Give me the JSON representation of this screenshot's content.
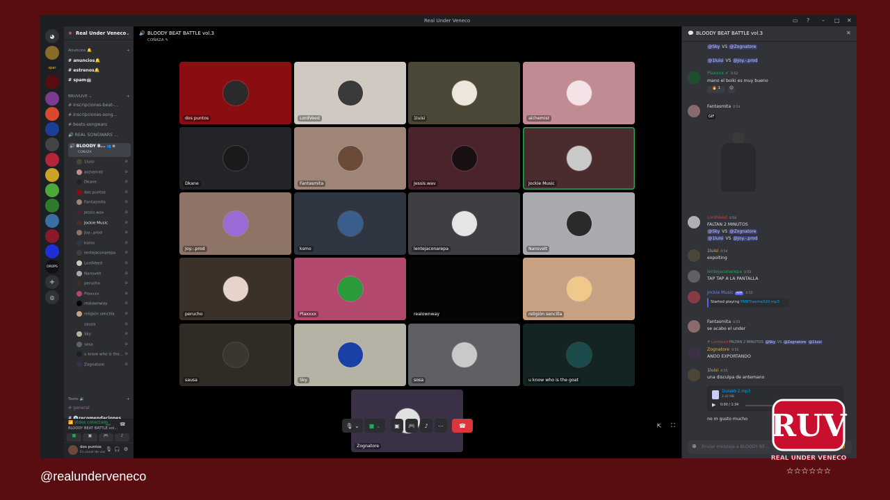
{
  "window": {
    "title": "Real Under Veneco"
  },
  "server": {
    "name": "Real Under Veneco"
  },
  "channels": {
    "cat_anuncios": "Anuncios",
    "anuncios": "anuncios",
    "estrenos": "estrenos",
    "spam": "spam",
    "cat_bruvlive": "BRUVLIVE",
    "inscripciones_beat": "inscripciones-beat-...",
    "inscripciones_song": "inscripciones-song...",
    "beats_songwars": "beats-songwars",
    "real_songwars": "REAL SONGWARS ...",
    "bloody": "BLOODY B...",
    "conaza": "COÑAZA",
    "cat_texto": "Texto",
    "general": "general",
    "recomendaciones": "recomendaciones"
  },
  "voice_members": [
    "1luisi",
    "alchemist",
    "Dkane",
    "dos puntos",
    "Fantasmita",
    "Jessis.wav",
    "Jockie Music",
    "Joy.-.prod",
    "ksmo",
    "lentejaconarepa",
    "LordVeed",
    "Nansvelt",
    "perucho",
    "Plaxxxx",
    "realownway",
    "religión sencilla",
    "sausa",
    "Sky",
    "sosa",
    "u know who is the...",
    "Zognatore"
  ],
  "voice_status": {
    "connected": "Video conectado",
    "channel": "BLOODY BEAT BATTLE vol..."
  },
  "user": {
    "name": "dos puntos",
    "status": "En canal de voz"
  },
  "call": {
    "title": "BLOODY BEAT BATTLE vol.3",
    "subtitle": "COÑAZA"
  },
  "tiles": [
    {
      "name": "dos puntos",
      "bg": "#8a0d12"
    },
    {
      "name": "LordVeed",
      "bg": "#cfc9c2"
    },
    {
      "name": "1luisi",
      "bg": "#4b4737"
    },
    {
      "name": "alchemist",
      "bg": "#c18b93"
    },
    {
      "name": "Dkane",
      "bg": "#232427"
    },
    {
      "name": "Fantasmita",
      "bg": "#9e8578"
    },
    {
      "name": "Jessis.wav",
      "bg": "#4b232b"
    },
    {
      "name": "Jockie Music",
      "bg": "#4b2c2e"
    },
    {
      "name": "Joy.-.prod",
      "bg": "#8e7367"
    },
    {
      "name": "ksmo",
      "bg": "#303641"
    },
    {
      "name": "lentejaconarepa",
      "bg": "#3e3f42"
    },
    {
      "name": "Nansvelt",
      "bg": "#a9aaad"
    },
    {
      "name": "perucho",
      "bg": "#3c3128"
    },
    {
      "name": "Plaxxxx",
      "bg": "#b2486d"
    },
    {
      "name": "realownway",
      "bg": "#050505"
    },
    {
      "name": "religión sencilla",
      "bg": "#c8a183"
    },
    {
      "name": "sausa",
      "bg": "#302b25"
    },
    {
      "name": "Sky",
      "bg": "#b5b3a5"
    },
    {
      "name": "sosa",
      "bg": "#5f6064"
    },
    {
      "name": "u know who is the goat",
      "bg": "#142423"
    },
    {
      "name": "Zognatore",
      "bg": "#3a3146"
    }
  ],
  "chat": {
    "title": "BLOODY BEAT BATTLE vol.3",
    "vs": "VS",
    "m_sky": "@Sky",
    "m_zog": "@Zognatore",
    "m_luisi": "@1luisi",
    "m_joy": "@Joy.-.prod",
    "plax_name": "Plaxxxx",
    "plax_time": "0:52",
    "plax_text": "mano el boiki es muy bueno",
    "fant_name": "Fantasmita",
    "fant_time": "0:54",
    "gif_label": "GIF",
    "lord_name": "LordVeed",
    "lord_time": "0:54",
    "lord_text": "FALTAN 2 MINUTOS",
    "luisi_name": "1luisi",
    "luisi_time": "0:54",
    "luisi_text": "expoiting",
    "lenteja_name": "lentejaconarepa",
    "lenteja_time": "0:55",
    "lenteja_text": "TAP TAP A LA PANTALLA",
    "jockie_name": "Jockie Music",
    "jockie_app": "APP",
    "jockie_time": "0:55",
    "jockie_playing": "Started playing",
    "jockie_track": "FANThasma320.mp3",
    "fant2_text": "se acabo el under",
    "reply_name": "LordVeed",
    "reply_text": "FALTAN 2 MINUTOS",
    "reply_mention": "@1luisi",
    "zog_name": "Zognatore",
    "zog_time": "0:55",
    "zog_text": "ANDO EXPORTANDO",
    "luisi2_time": "0:55",
    "luisi2_text": "una disculpa de antemano",
    "file_name": "1luisbb 2.mp3",
    "file_size": "2.42 MB",
    "file_time": "0:00 / 1:34",
    "last_text": "no m gusto mucho",
    "input_placeholder": "Enviar mensaje a BLOODY BE..."
  },
  "overlay": {
    "handle": "@realunderveneco",
    "logo_big": "RUV",
    "logo_text": "REAL UNDER VENECO"
  },
  "colors": {
    "accent": "#5865f2",
    "green": "#23a55a",
    "red": "#da373c",
    "frame": "#5a0d10",
    "logo": "#c8102e"
  }
}
